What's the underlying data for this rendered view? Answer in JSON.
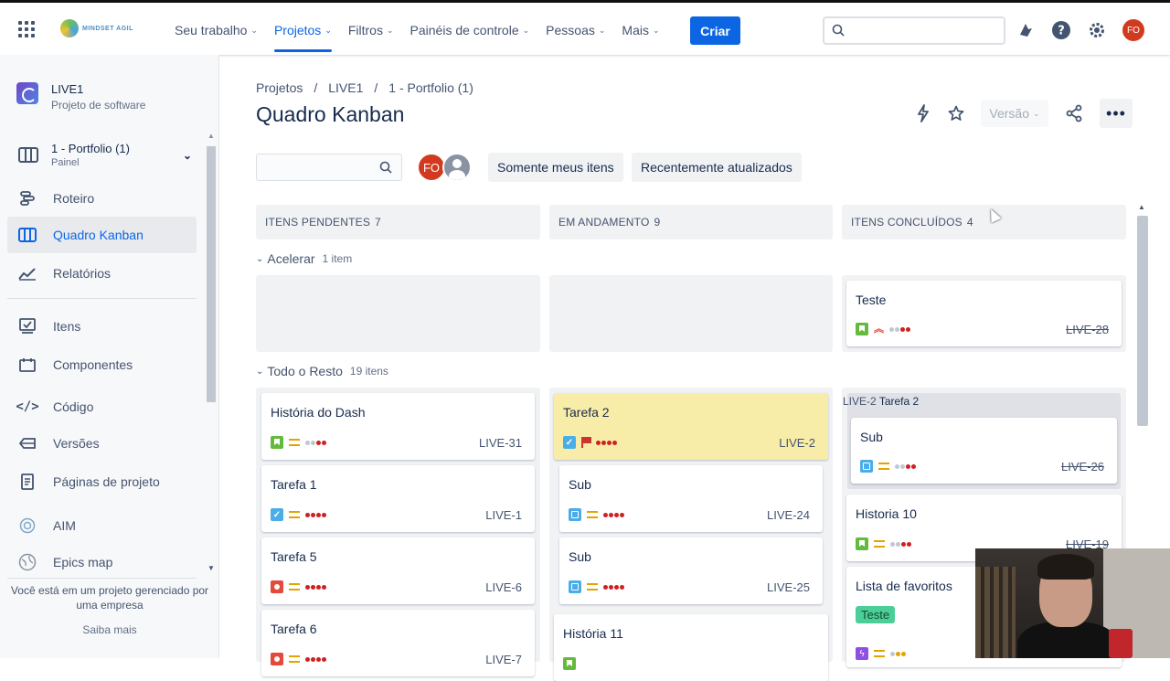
{
  "topbar": {
    "logo_text": "MINDSET AGIL",
    "nav": [
      {
        "label": "Seu trabalho"
      },
      {
        "label": "Projetos"
      },
      {
        "label": "Filtros"
      },
      {
        "label": "Painéis de controle"
      },
      {
        "label": "Pessoas"
      },
      {
        "label": "Mais"
      }
    ],
    "create_label": "Criar",
    "search_placeholder": "",
    "user_initials": "FO",
    "brand_color": "#0c66e4"
  },
  "sidebar": {
    "project_name": "LIVE1",
    "project_type": "Projeto de software",
    "board_name": "1 - Portfolio (1)",
    "board_type": "Painel",
    "items": [
      {
        "label": "Roteiro",
        "icon": "roadmap-icon"
      },
      {
        "label": "Quadro Kanban",
        "icon": "board-icon"
      },
      {
        "label": "Relatórios",
        "icon": "reports-icon"
      },
      {
        "label": "Itens",
        "icon": "issues-icon"
      },
      {
        "label": "Componentes",
        "icon": "components-icon"
      },
      {
        "label": "Código",
        "icon": "code-icon"
      },
      {
        "label": "Versões",
        "icon": "releases-icon"
      },
      {
        "label": "Páginas de projeto",
        "icon": "pages-icon"
      },
      {
        "label": "AIM",
        "icon": "aim-icon"
      },
      {
        "label": "Epics map",
        "icon": "epics-map-icon"
      }
    ],
    "footer_text": "Você está em um projeto gerenciado por uma empresa",
    "footer_link": "Saiba mais"
  },
  "main": {
    "breadcrumbs": [
      "Projetos",
      "/",
      "LIVE1",
      "/",
      "1 - Portfolio (1)"
    ],
    "title": "Quadro Kanban",
    "version_label": "Versão",
    "search_placeholder": "",
    "avatar_initials": "FO",
    "filters": [
      "Somente meus itens",
      "Recentemente atualizados"
    ]
  },
  "board": {
    "columns": [
      {
        "title": "ITENS PENDENTES",
        "count": "7"
      },
      {
        "title": "EM ANDAMENTO",
        "count": "9"
      },
      {
        "title": "ITENS CONCLUÍDOS",
        "count": "4"
      }
    ],
    "swimlanes": [
      {
        "title": "Acelerar",
        "count": "1 item"
      },
      {
        "title": "Todo o Resto",
        "count": "19 itens"
      }
    ],
    "cards": [
      {
        "title": "Teste",
        "key": "LIVE-28"
      },
      {
        "title": "História do Dash",
        "key": "LIVE-31"
      },
      {
        "title": "Tarefa 1",
        "key": "LIVE-1"
      },
      {
        "title": "Tarefa 5",
        "key": "LIVE-6"
      },
      {
        "title": "Tarefa 6",
        "key": "LIVE-7"
      },
      {
        "title": "Tarefa 2",
        "key": "LIVE-2"
      },
      {
        "title": "Sub",
        "key": "LIVE-24"
      },
      {
        "title": "Sub",
        "key": "LIVE-25"
      },
      {
        "title": "História 11",
        "key": ""
      },
      {
        "title": "Sub",
        "key": "LIVE-26"
      },
      {
        "title": "Historia 10",
        "key": "LIVE-19"
      },
      {
        "title": "Lista de favoritos",
        "key": ""
      }
    ],
    "parent_key": "LIVE-2",
    "parent_title": "Tarefa 2",
    "label_teste": "Teste"
  }
}
